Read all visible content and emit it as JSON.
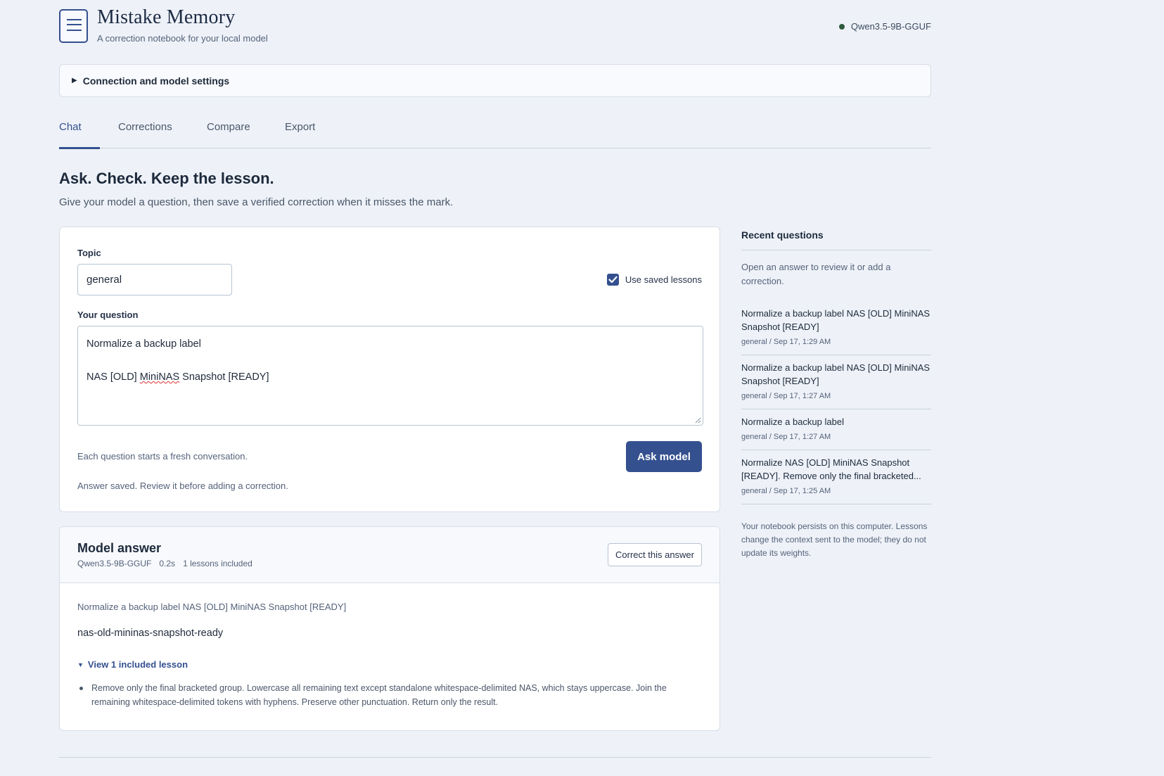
{
  "header": {
    "title": "Mistake Memory",
    "subtitle": "A correction notebook for your local model",
    "model_status": "Qwen3.5-9B-GGUF"
  },
  "settings": {
    "label": "Connection and model settings"
  },
  "tabs": [
    {
      "label": "Chat",
      "active": true
    },
    {
      "label": "Corrections"
    },
    {
      "label": "Compare"
    },
    {
      "label": "Export"
    }
  ],
  "page": {
    "title": "Ask. Check. Keep the lesson.",
    "lead": "Give your model a question, then save a verified correction when it misses the mark."
  },
  "form": {
    "topic_label": "Topic",
    "topic_value": "general",
    "use_lessons_label": "Use saved lessons",
    "use_lessons_checked": true,
    "question_label": "Your question",
    "question_line1": "Normalize a backup label",
    "question_line2_a": "NAS [OLD] ",
    "question_line2_b": "MiniNAS",
    "question_line2_c": " Snapshot [READY]",
    "hint": "Each question starts a fresh conversation.",
    "ask_label": "Ask model",
    "saved_message": "Answer saved. Review it before adding a correction."
  },
  "answer": {
    "title": "Model answer",
    "model": "Qwen3.5-9B-GGUF",
    "duration": "0.2s",
    "lessons_count": "1 lessons included",
    "correct_label": "Correct this answer",
    "prompt": "Normalize a backup label NAS [OLD] MiniNAS Snapshot [READY]",
    "text": "nas-old-mininas-snapshot-ready",
    "lesson_toggle": "View 1 included lesson",
    "lessons": [
      "Remove only the final bracketed group. Lowercase all remaining text except standalone whitespace-delimited NAS, which stays uppercase. Join the remaining whitespace-delimited tokens with hyphens. Preserve other punctuation. Return only the result."
    ]
  },
  "sidebar": {
    "title": "Recent questions",
    "help": "Open an answer to review it or add a correction.",
    "items": [
      {
        "text": "Normalize a backup label NAS [OLD] MiniNAS Snapshot [READY]",
        "meta": "general / Sep 17, 1:29 AM"
      },
      {
        "text": "Normalize a backup label NAS [OLD] MiniNAS Snapshot [READY]",
        "meta": "general / Sep 17, 1:27 AM"
      },
      {
        "text": "Normalize a backup label",
        "meta": "general / Sep 17, 1:27 AM"
      },
      {
        "text": "Normalize NAS [OLD] MiniNAS Snapshot [READY]. Remove only the final bracketed...",
        "meta": "general / Sep 17, 1:25 AM"
      }
    ],
    "footer": "Your notebook persists on this computer. Lessons change the context sent to the model; they do not update its weights."
  },
  "colors": {
    "accent": "#34508f",
    "status_dot": "#2d5a3c",
    "background": "#eef2f8"
  },
  "icons": {
    "logo": "notebook-icon",
    "settings_toggle": "triangle-right-icon",
    "checkbox": "check-icon",
    "lesson_toggle": "triangle-down-icon"
  }
}
